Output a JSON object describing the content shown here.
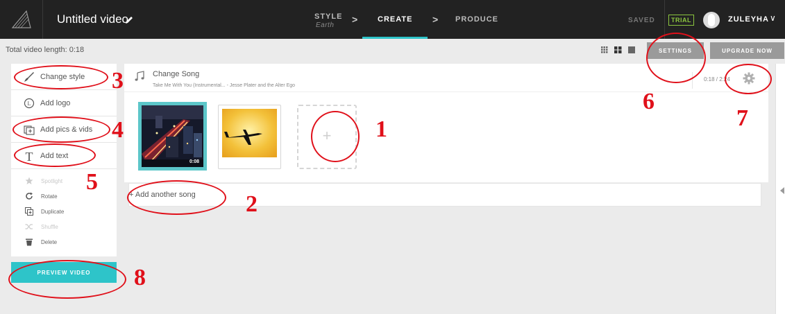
{
  "topbar": {
    "title": "Untitled video",
    "steps": [
      {
        "label": "STYLE",
        "sub": "Earth"
      },
      {
        "label": "CREATE"
      },
      {
        "label": "PRODUCE"
      }
    ],
    "separator": ">",
    "saved": "SAVED",
    "trial": "TRIAL",
    "username": "ZULEYHA",
    "user_chevron": "∨",
    "accent": "#2ec4c9",
    "trial_color": "#8cc63f"
  },
  "toolbar": {
    "video_length": "Total video length: 0:18",
    "settings_label": "SETTINGS",
    "upgrade_label": "UPGRADE NOW"
  },
  "sidebar": {
    "items": [
      {
        "label": "Change style",
        "icon": "brush-icon"
      },
      {
        "label": "Add logo",
        "icon": "logo-icon"
      },
      {
        "label": "Add pics & vids",
        "icon": "media-icon"
      },
      {
        "label": "Add text",
        "icon": "text-icon"
      }
    ],
    "actions": [
      {
        "label": "Spotlight",
        "icon": "star-icon",
        "enabled": false
      },
      {
        "label": "Rotate",
        "icon": "rotate-icon",
        "enabled": true
      },
      {
        "label": "Duplicate",
        "icon": "duplicate-icon",
        "enabled": true
      },
      {
        "label": "Shuffle",
        "icon": "shuffle-icon",
        "enabled": false
      },
      {
        "label": "Delete",
        "icon": "trash-icon",
        "enabled": true
      }
    ],
    "preview_label": "PREVIEW VIDEO"
  },
  "song": {
    "title": "Change Song",
    "artist": "Take Me With You (Instrumental... - Jesse Plater and the Alter Ego",
    "time": "0:18 / 2:24",
    "add_another": "+ Add another song"
  },
  "media": {
    "thumb1_duration": "0:08",
    "add_symbol": "+"
  },
  "annotations": {
    "numbers": [
      "1",
      "2",
      "3",
      "4",
      "5",
      "6",
      "7",
      "8"
    ],
    "color": "#e0101a"
  }
}
